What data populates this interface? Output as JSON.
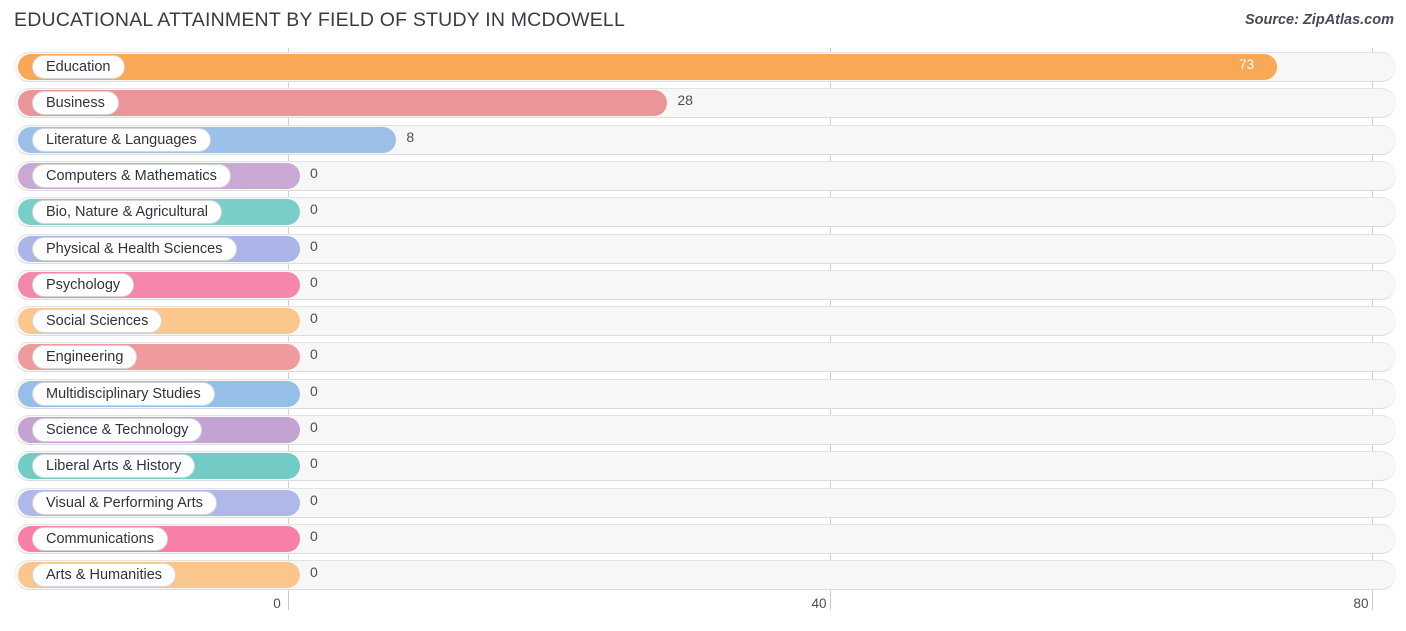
{
  "header": {
    "title": "EDUCATIONAL ATTAINMENT BY FIELD OF STUDY IN MCDOWELL",
    "source": "Source: ZipAtlas.com"
  },
  "chart_data": {
    "type": "bar",
    "orientation": "horizontal",
    "title": "EDUCATIONAL ATTAINMENT BY FIELD OF STUDY IN MCDOWELL",
    "xlabel": "",
    "ylabel": "",
    "xlim": [
      0,
      80
    ],
    "xticks": [
      0,
      40,
      80
    ],
    "xtick_labels": [
      "0",
      "40",
      "80"
    ],
    "grid": true,
    "legend": "none",
    "categories": [
      "Education",
      "Business",
      "Literature & Languages",
      "Computers & Mathematics",
      "Bio, Nature & Agricultural",
      "Physical & Health Sciences",
      "Psychology",
      "Social Sciences",
      "Engineering",
      "Multidisciplinary Studies",
      "Science & Technology",
      "Liberal Arts & History",
      "Visual & Performing Arts",
      "Communications",
      "Arts & Humanities"
    ],
    "values": [
      73,
      28,
      8,
      0,
      0,
      0,
      0,
      0,
      0,
      0,
      0,
      0,
      0,
      0,
      0
    ],
    "value_labels": [
      "73",
      "28",
      "8",
      "0",
      "0",
      "0",
      "0",
      "0",
      "0",
      "0",
      "0",
      "0",
      "0",
      "0",
      "0"
    ],
    "bar_colors": [
      "#f9a855",
      "#ea9597",
      "#9cc0e7",
      "#c9a8d4",
      "#79cfc8",
      "#adb5e8",
      "#f786ad",
      "#fbc78a",
      "#ef9a9c",
      "#95bfe9",
      "#c4a3d2",
      "#72cbc4",
      "#b0b7e9",
      "#f87fa8",
      "#fbc68b"
    ]
  }
}
